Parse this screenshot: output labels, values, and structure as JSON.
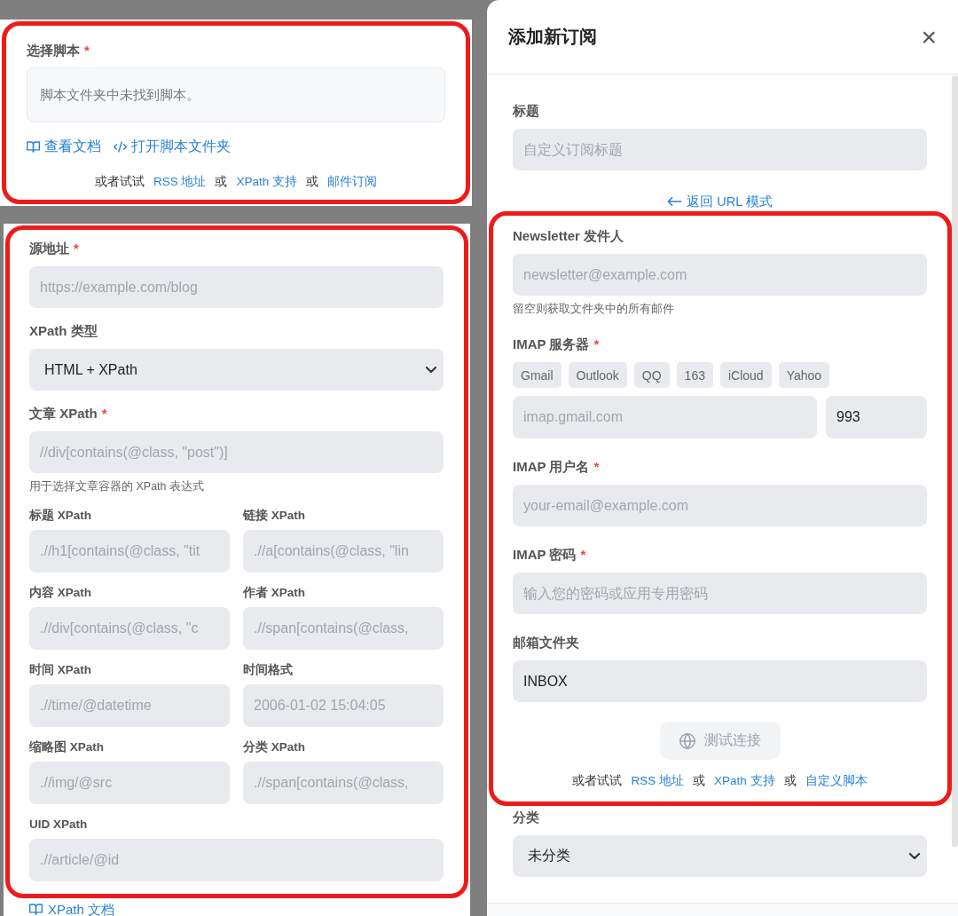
{
  "script_panel": {
    "highlighted": true,
    "label": "选择脚本",
    "required_mark": "*",
    "notice": "脚本文件夹中未找到脚本。",
    "links": [
      {
        "kind": "docs",
        "text": "查看文档"
      },
      {
        "kind": "folder",
        "text": "打开脚本文件夹"
      }
    ],
    "alternatives": [
      {
        "kind": "text",
        "text": "或者试试"
      },
      {
        "kind": "link",
        "text": "RSS 地址"
      },
      {
        "kind": "text",
        "text": "或"
      },
      {
        "kind": "link",
        "text": "XPath 支持"
      },
      {
        "kind": "text",
        "text": "或"
      },
      {
        "kind": "link",
        "text": "邮件订阅"
      }
    ]
  },
  "xpath_panel": {
    "highlighted": true,
    "fields": [
      {
        "kind": "input",
        "label": "源地址",
        "required_mark": "*",
        "placeholder": "https://example.com/blog"
      },
      {
        "kind": "select",
        "label": "XPath 类型",
        "value": "HTML + XPath"
      },
      {
        "kind": "input",
        "label": "文章 XPath",
        "required_mark": "*",
        "placeholder": "//div[contains(@class, \"post\")]",
        "hint": "用于选择文章容器的 XPath 表达式"
      }
    ],
    "optional_fields": [
      {
        "kind": "input",
        "label": "标题 XPath",
        "placeholder": ".//h1[contains(@class, \"tit"
      },
      {
        "kind": "input",
        "label": "链接 XPath",
        "placeholder": ".//a[contains(@class, \"lin"
      },
      {
        "kind": "input",
        "label": "内容 XPath",
        "placeholder": ".//div[contains(@class, \"c"
      },
      {
        "kind": "input",
        "label": "作者 XPath",
        "placeholder": ".//span[contains(@class,"
      },
      {
        "kind": "input",
        "label": "时间 XPath",
        "placeholder": ".//time/@datetime"
      },
      {
        "kind": "input",
        "label": "时间格式",
        "placeholder": "2006-01-02 15:04:05"
      },
      {
        "kind": "input",
        "label": "缩略图 XPath",
        "placeholder": ".//img/@src"
      },
      {
        "kind": "input",
        "label": "分类 XPath",
        "placeholder": ".//span[contains(@class,"
      },
      {
        "kind": "input",
        "label": "UID XPath",
        "placeholder": ".//article/@id"
      }
    ],
    "docs_link": {
      "kind": "docs",
      "text": "XPath 文档"
    }
  },
  "dialog": {
    "title": "添加新订阅",
    "close": "×",
    "title_field": {
      "kind": "input",
      "label": "标题",
      "placeholder": "自定义订阅标题"
    },
    "back_link": "返回 URL 模式",
    "email_section": {
      "highlighted": true,
      "fields": [
        {
          "kind": "input",
          "label": "Newsletter 发件人",
          "placeholder": "newsletter@example.com",
          "hint": "留空则获取文件夹中的所有邮件"
        },
        {
          "kind": "server",
          "label": "IMAP 服务器",
          "required_mark": "*",
          "presets": [
            "Gmail",
            "Outlook",
            "QQ",
            "163",
            "iCloud",
            "Yahoo"
          ],
          "host_placeholder": "imap.gmail.com",
          "port": "993"
        },
        {
          "kind": "input",
          "label": "IMAP 用户名",
          "required_mark": "*",
          "placeholder": "your-email@example.com"
        },
        {
          "kind": "input",
          "label": "IMAP 密码",
          "required_mark": "*",
          "placeholder": "输入您的密码或应用专用密码"
        },
        {
          "kind": "input",
          "label": "邮箱文件夹",
          "value": "INBOX"
        }
      ],
      "test_button": {
        "label": "测试连接",
        "disabled": true
      },
      "alternatives": [
        {
          "kind": "text",
          "text": "或者试试"
        },
        {
          "kind": "link",
          "text": "RSS 地址"
        },
        {
          "kind": "text",
          "text": "或"
        },
        {
          "kind": "link",
          "text": "XPath 支持"
        },
        {
          "kind": "text",
          "text": "或"
        },
        {
          "kind": "link",
          "text": "自定义脚本"
        }
      ]
    },
    "category": {
      "kind": "select",
      "label": "分类",
      "value": "未分类"
    }
  }
}
